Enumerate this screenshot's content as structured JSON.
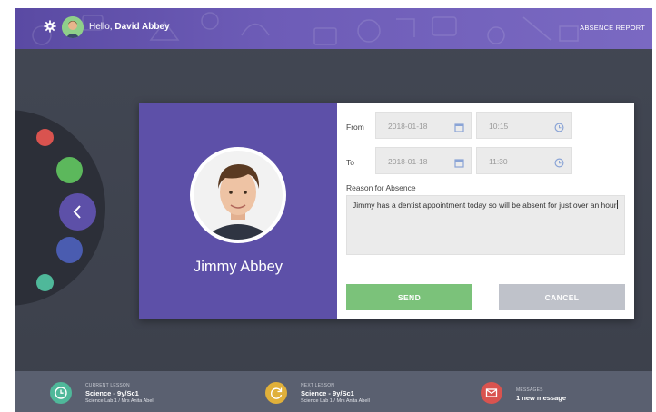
{
  "header": {
    "greeting": "Hello, ",
    "user_name": "David Abbey",
    "report_link": "ABSENCE REPORT"
  },
  "student": {
    "name": "Jimmy Abbey"
  },
  "form": {
    "from_label": "From",
    "to_label": "To",
    "from_date": "2018-01-18",
    "from_time": "10:15",
    "to_date": "2018-01-18",
    "to_time": "11:30",
    "reason_label": "Reason for Absence",
    "reason_text": "Jimmy has a dentist appointment today so will be absent for just over an hour",
    "send_label": "SEND",
    "cancel_label": "CANCEL"
  },
  "footer": {
    "current": {
      "caption": "CURRENT LESSON",
      "title": "Science - 9y/Sc1",
      "detail": "Science Lab 1 / Mrs Anita Abell"
    },
    "next": {
      "caption": "NEXT LESSON",
      "title": "Science - 9y/Sc1",
      "detail": "Science Lab 1 / Mrs Anita Abell"
    },
    "messages": {
      "caption": "MESSAGES",
      "title": "1 new message"
    }
  },
  "colors": {
    "header": "#6a59b4",
    "accent_purple": "#5d50a8",
    "send": "#7bc27a",
    "cancel": "#bfc2ca",
    "footer": "#5a6070",
    "current_icon": "#4fb89a",
    "next_icon": "#e0b03a",
    "messages_icon": "#d9534f",
    "wheel_red": "#d9534f",
    "wheel_green": "#5cb85c",
    "wheel_blue": "#4a5cb0",
    "wheel_teal": "#4fb89a"
  },
  "icons": {
    "settings": "gear-icon",
    "calendar": "calendar-icon",
    "clock": "clock-icon",
    "back": "chevron-left-icon",
    "next_lesson": "refresh-clock-icon",
    "messages": "envelope-icon"
  }
}
